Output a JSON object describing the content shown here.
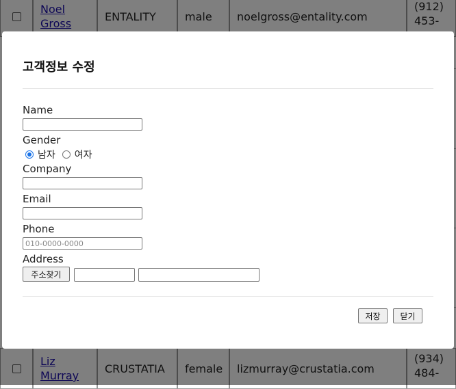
{
  "rows": [
    {
      "name_line1": "Noel",
      "name_line2": "Gross",
      "company": "ENTALITY",
      "gender": "male",
      "email": "noelgross@entality.com",
      "phone_line1": "(912)",
      "phone_line2": "453-"
    },
    {
      "name_line1": "Liz",
      "name_line2": "Murray",
      "company": "CRUSTATIA",
      "gender": "female",
      "email": "lizmurray@crustatia.com",
      "phone_line1": "(934)",
      "phone_line2": "484-"
    }
  ],
  "modal": {
    "title": "고객정보 수정",
    "labels": {
      "name": "Name",
      "gender": "Gender",
      "company": "Company",
      "email": "Email",
      "phone": "Phone",
      "address": "Address"
    },
    "gender_options": [
      "남자",
      "여자"
    ],
    "gender_selected": "남자",
    "phone_placeholder": "010-0000-0000",
    "find_address_button": "주소찾기",
    "save_button": "저장",
    "close_button": "닫기"
  }
}
